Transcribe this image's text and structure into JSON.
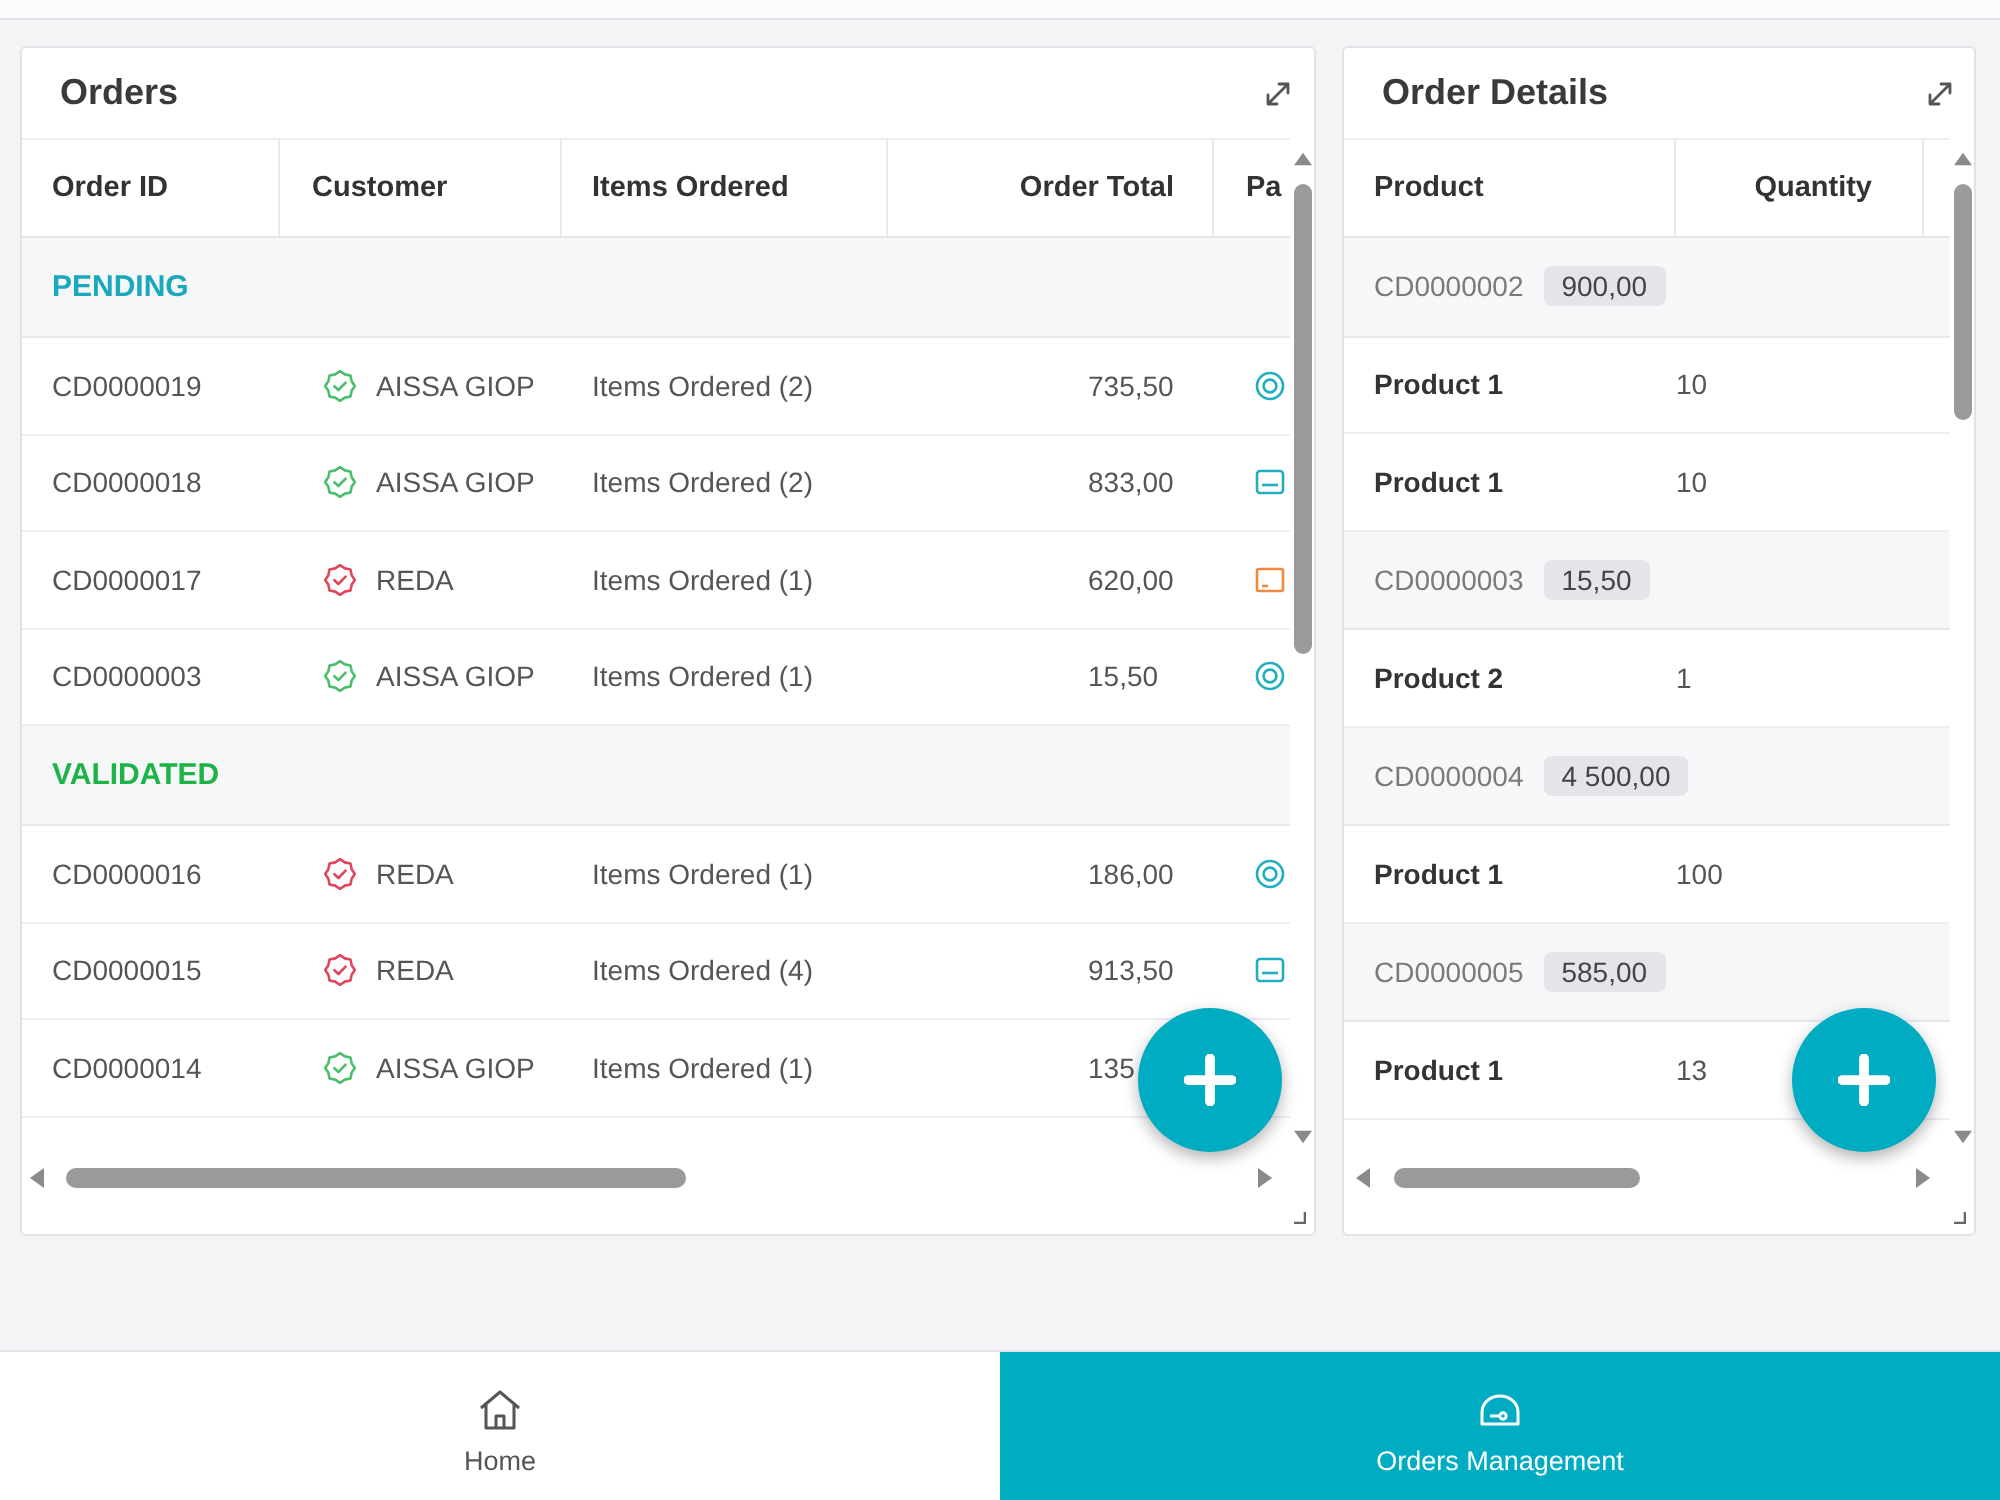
{
  "orders": {
    "title": "Orders",
    "columns": [
      "Order ID",
      "Customer",
      "Items Ordered",
      "Order Total",
      "Pa"
    ],
    "groups": [
      {
        "label": "PENDING",
        "color": "#1aa9bc",
        "rows": [
          {
            "order_id": "CD0000019",
            "customer": {
              "name": "AISSA GIOP",
              "color": "#4cbf6b"
            },
            "items": "Items Ordered (2)",
            "total": "735,50",
            "payment": {
              "kind": "cash"
            }
          },
          {
            "order_id": "CD0000018",
            "customer": {
              "name": "AISSA GIOP",
              "color": "#4cbf6b"
            },
            "items": "Items Ordered (2)",
            "total": "833,00",
            "payment": {
              "kind": "card"
            }
          },
          {
            "order_id": "CD0000017",
            "customer": {
              "name": "REDA",
              "color": "#e0475b"
            },
            "items": "Items Ordered (1)",
            "total": "620,00",
            "payment": {
              "kind": "bill"
            }
          },
          {
            "order_id": "CD0000003",
            "customer": {
              "name": "AISSA GIOP",
              "color": "#4cbf6b"
            },
            "items": "Items Ordered (1)",
            "total": "15,50",
            "payment": {
              "kind": "cash"
            }
          }
        ]
      },
      {
        "label": "VALIDATED",
        "color": "#1db347",
        "rows": [
          {
            "order_id": "CD0000016",
            "customer": {
              "name": "REDA",
              "color": "#e0475b"
            },
            "items": "Items Ordered (1)",
            "total": "186,00",
            "payment": {
              "kind": "cash"
            }
          },
          {
            "order_id": "CD0000015",
            "customer": {
              "name": "REDA",
              "color": "#e0475b"
            },
            "items": "Items Ordered (4)",
            "total": "913,50",
            "payment": {
              "kind": "card"
            }
          },
          {
            "order_id": "CD0000014",
            "customer": {
              "name": "AISSA GIOP",
              "color": "#4cbf6b"
            },
            "items": "Items Ordered (1)",
            "total": "135"
          }
        ]
      }
    ]
  },
  "order_details": {
    "title": "Order Details",
    "columns": [
      "Product",
      "Quantity"
    ],
    "groups": [
      {
        "order_id": "CD0000002",
        "total": "900,00",
        "items": [
          {
            "product": "Product 1",
            "quantity": "10"
          },
          {
            "product": "Product 1",
            "quantity": "10"
          }
        ]
      },
      {
        "order_id": "CD0000003",
        "total": "15,50",
        "items": [
          {
            "product": "Product 2",
            "quantity": "1"
          }
        ]
      },
      {
        "order_id": "CD0000004",
        "total": "4 500,00",
        "items": [
          {
            "product": "Product 1",
            "quantity": "100"
          }
        ]
      },
      {
        "order_id": "CD0000005",
        "total": "585,00",
        "items": [
          {
            "product": "Product 1",
            "quantity": "13"
          }
        ]
      }
    ]
  },
  "nav": {
    "items": [
      {
        "label": "Home",
        "selected": false
      },
      {
        "label": "Orders Management",
        "selected": true
      }
    ]
  }
}
